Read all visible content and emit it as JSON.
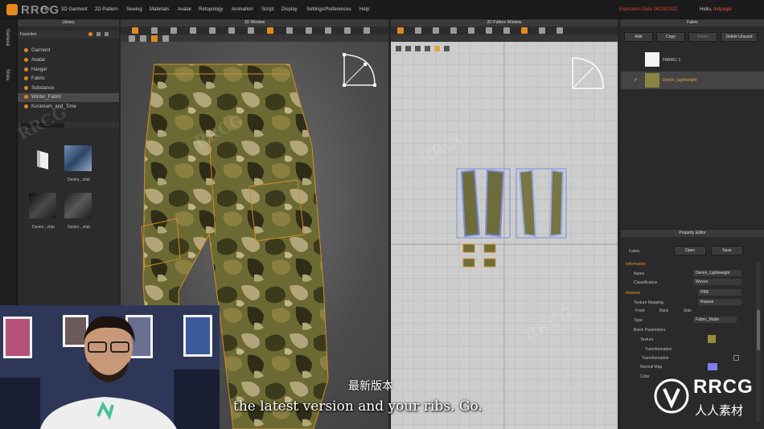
{
  "app": {
    "watermark": "RRCG",
    "menu": [
      "File",
      "3D Garment",
      "2D Pattern",
      "Sewing",
      "Materials",
      "Avatar",
      "Retopology",
      "Animation",
      "Script",
      "Display",
      "Settings/Preferences",
      "Help"
    ],
    "expiration": "Expiration Date 06/29/2022",
    "hello_prefix": "Hello,",
    "hello_user": "delpager"
  },
  "side_tabs": [
    "General",
    "Store"
  ],
  "library": {
    "title": "Library",
    "favorites_label": "Favorites",
    "items": [
      "Garment",
      "Avatar",
      "Hanger",
      "Fabric",
      "Substance",
      "Winter_Fabric",
      "Kuramam_and_Time"
    ],
    "selected_index": 3,
    "thumbs": [
      "",
      "Denim...zfab",
      "Denim...zfab",
      "Denim...zfab"
    ]
  },
  "win3d": {
    "title": "3D Window"
  },
  "win2d": {
    "title": "2D Pattern Window"
  },
  "fabric": {
    "title": "Fabric",
    "buttons": [
      "Add",
      "Copy",
      "Delete",
      "Delete Unused"
    ],
    "items": [
      "FABRIC 1",
      "Denim_Lightweight"
    ]
  },
  "property_editor": {
    "title": "Property Editor",
    "fabric_label": "Fabric",
    "open_btn": "Open",
    "save_btn": "Save",
    "information": "Information",
    "name_label": "Name",
    "name_value": "Denim_Lightweight",
    "classification_label": "Classification",
    "classification_value": "Woven",
    "material": "Material",
    "material_type": "PBR",
    "texture_mapping_label": "Texture Mapping",
    "texture_mapping_value": "Repeat",
    "faces": [
      "Front",
      "Back",
      "Side"
    ],
    "type_label": "Type",
    "type_value": "Fabric_Matte",
    "basic_params": "Basic Parameters",
    "texture_label": "Texture",
    "transformation_label": "Transformation",
    "transformation_label2": "Transformation",
    "normal_map_label": "Normal Map",
    "color_label": "Color",
    "colors": {
      "swatch": "#7f7ff0",
      "texture": "#9b8a3a"
    }
  },
  "subtitles": {
    "cn": "最新版本",
    "en": "the latest version and your ribs. Go."
  },
  "brand": {
    "name": "RRCG",
    "sub": "人人素材"
  }
}
